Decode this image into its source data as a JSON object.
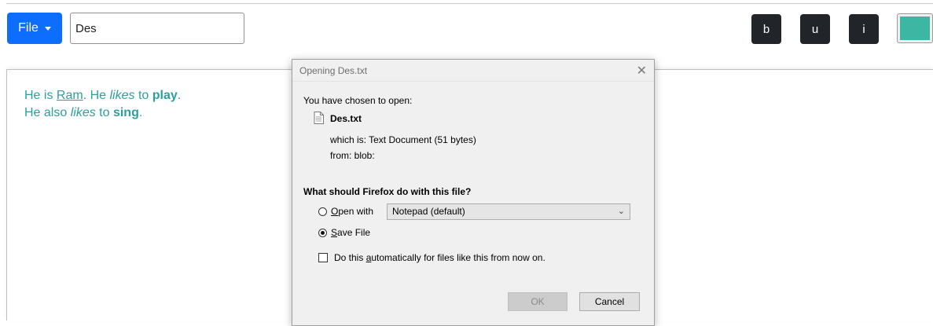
{
  "toolbar": {
    "file_label": "File",
    "filename_value": "Des",
    "bold_label": "b",
    "underline_label": "u",
    "italic_label": "i",
    "color_value": "#3bb7a3"
  },
  "editor": {
    "line1": [
      "He is ",
      "Ram",
      ". He ",
      "likes",
      " to ",
      "play",
      "."
    ],
    "line2": [
      "He also ",
      "likes",
      " to ",
      "sing",
      "."
    ],
    "text_color": "#2d9e9e"
  },
  "dialog": {
    "title": "Opening Des.txt",
    "close_glyph": "✕",
    "chosen_text": "You have chosen to open:",
    "file_name": "Des.txt",
    "which_is": "which is:  Text Document (51 bytes)",
    "from": "from:  blob:",
    "question": "What should Firefox do with this file?",
    "open_with_prefix": "",
    "open_with_mnemonic": "O",
    "open_with_rest": "pen with",
    "open_with_app": "Notepad (default)",
    "save_mnemonic": "S",
    "save_rest": "ave File",
    "auto_prefix": "Do this ",
    "auto_mnemonic": "a",
    "auto_rest": "utomatically for files like this from now on.",
    "ok_label": "OK",
    "cancel_label": "Cancel",
    "selected_option": "save"
  },
  "colors": {
    "primary": "#0d6efd",
    "dark": "#212529"
  }
}
